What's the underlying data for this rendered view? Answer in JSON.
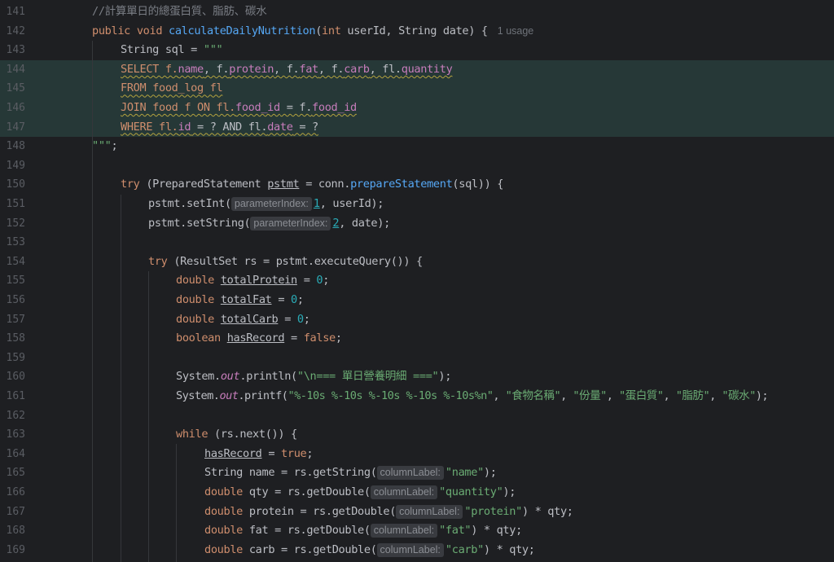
{
  "editor": {
    "first_line_number": 141,
    "language": "Java",
    "colors": {
      "background": "#1e1f22",
      "keyword": "#cf8e6d",
      "method": "#56a8f5",
      "string": "#6aab73",
      "number": "#2aacb8",
      "field": "#c77dbb",
      "comment": "#7a7e85",
      "highlight": "#263837"
    },
    "lines": [
      {
        "number": "141",
        "t": [
          "//計算單日的總蛋白質、脂肪、碳水"
        ]
      },
      {
        "number": "142",
        "t": [
          "public void ",
          "calculateDailyNutrition",
          "(",
          "int ",
          "userId, ",
          "String ",
          "date) {",
          "1 usage"
        ]
      },
      {
        "number": "143",
        "t": [
          "String sql = ",
          "\"\"\""
        ]
      },
      {
        "number": "144",
        "t": [
          "SELECT f.",
          "name",
          ", f.",
          "protein",
          ", f.",
          "fat",
          ", f.",
          "carb",
          ", fl.",
          "quantity"
        ]
      },
      {
        "number": "145",
        "t": [
          "FROM food_log fl"
        ]
      },
      {
        "number": "146",
        "t": [
          "JOIN food f ON fl.",
          "food_id",
          " = f.",
          "food_id"
        ]
      },
      {
        "number": "147",
        "t": [
          "WHERE fl.",
          "id",
          " = ? AND fl.",
          "date",
          " = ?"
        ]
      },
      {
        "number": "148",
        "t": [
          "\"\"\"",
          ";"
        ]
      },
      {
        "number": "149",
        "t": []
      },
      {
        "number": "150",
        "t": [
          "try ",
          "(PreparedStatement ",
          "pstmt",
          " = conn.",
          "prepareStatement",
          "(sql)) {"
        ]
      },
      {
        "number": "151",
        "t": [
          "pstmt.",
          "setInt",
          "(",
          "parameterIndex:",
          "1",
          ", userId);"
        ]
      },
      {
        "number": "152",
        "t": [
          "pstmt.",
          "setString",
          "(",
          "parameterIndex:",
          "2",
          ", date);"
        ]
      },
      {
        "number": "153",
        "t": []
      },
      {
        "number": "154",
        "t": [
          "try ",
          "(ResultSet rs = pstmt.",
          "executeQuery",
          "()) {"
        ]
      },
      {
        "number": "155",
        "t": [
          "double ",
          "totalProtein",
          " = ",
          "0",
          ";"
        ]
      },
      {
        "number": "156",
        "t": [
          "double ",
          "totalFat",
          " = ",
          "0",
          ";"
        ]
      },
      {
        "number": "157",
        "t": [
          "double ",
          "totalCarb",
          " = ",
          "0",
          ";"
        ]
      },
      {
        "number": "158",
        "t": [
          "boolean ",
          "hasRecord",
          " = ",
          "false",
          ";"
        ]
      },
      {
        "number": "159",
        "t": []
      },
      {
        "number": "160",
        "t": [
          "System.",
          "out",
          ".println(",
          "\"\\n=== 單日營養明細 ===\"",
          ");"
        ]
      },
      {
        "number": "161",
        "t": [
          "System.",
          "out",
          ".printf(",
          "\"%-10s %-10s %-10s %-10s %-10s%n\"",
          ", ",
          "\"食物名稱\"",
          ", ",
          "\"份量\"",
          ", ",
          "\"蛋白質\"",
          ", ",
          "\"脂肪\"",
          ", ",
          "\"碳水\"",
          ");"
        ]
      },
      {
        "number": "162",
        "t": []
      },
      {
        "number": "163",
        "t": [
          "while ",
          "(rs.",
          "next",
          "()) {"
        ]
      },
      {
        "number": "164",
        "t": [
          "hasRecord",
          " = ",
          "true",
          ";"
        ]
      },
      {
        "number": "165",
        "t": [
          "String name = rs.",
          "getString",
          "(",
          "columnLabel:",
          "\"name\"",
          ");"
        ]
      },
      {
        "number": "166",
        "t": [
          "double ",
          "qty = rs.",
          "getDouble",
          "(",
          "columnLabel:",
          "\"quantity\"",
          ");"
        ]
      },
      {
        "number": "167",
        "t": [
          "double ",
          "protein = rs.",
          "getDouble",
          "(",
          "columnLabel:",
          "\"protein\"",
          ") * qty;"
        ]
      },
      {
        "number": "168",
        "t": [
          "double ",
          "fat = rs.",
          "getDouble",
          "(",
          "columnLabel:",
          "\"fat\"",
          ") * qty;"
        ]
      },
      {
        "number": "169",
        "t": [
          "double ",
          "carb = rs.",
          "getDouble",
          "(",
          "columnLabel:",
          "\"carb\"",
          ") * qty;"
        ]
      }
    ]
  }
}
